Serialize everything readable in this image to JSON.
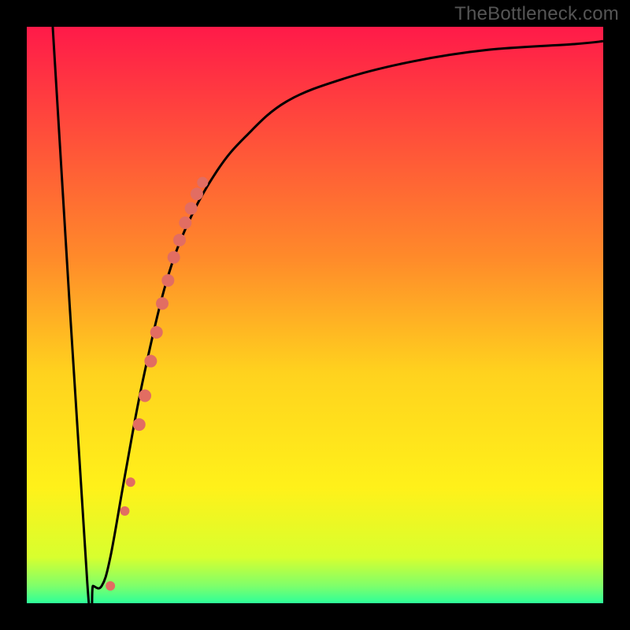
{
  "watermark": {
    "text": "TheBottleneck.com"
  },
  "chart_data": {
    "type": "line",
    "title": "",
    "xlabel": "",
    "ylabel": "",
    "xlim": [
      0,
      100
    ],
    "ylim": [
      0,
      100
    ],
    "grid": false,
    "background_gradient_stops": [
      {
        "offset": 0.0,
        "color": "#ff1a49"
      },
      {
        "offset": 0.4,
        "color": "#ff8a2a"
      },
      {
        "offset": 0.6,
        "color": "#ffd21e"
      },
      {
        "offset": 0.8,
        "color": "#fff11a"
      },
      {
        "offset": 0.92,
        "color": "#d8ff2e"
      },
      {
        "offset": 0.97,
        "color": "#7eff6b"
      },
      {
        "offset": 1.0,
        "color": "#2dff9a"
      }
    ],
    "series": [
      {
        "name": "bottleneck-curve",
        "color": "#000000",
        "x": [
          4.5,
          10.5,
          11.5,
          13,
          14.5,
          17,
          20,
          24,
          28,
          33,
          38,
          45,
          55,
          67,
          80,
          95,
          100
        ],
        "values": [
          100,
          3.5,
          3.0,
          3,
          8,
          22,
          38,
          55,
          66,
          75,
          81,
          87,
          91,
          94,
          96,
          97,
          97.5
        ]
      }
    ],
    "highlight_points": {
      "name": "highlight-dots",
      "color": "#e26d62",
      "x": [
        14.5,
        17.0,
        18.0,
        19.5,
        20.5,
        21.5,
        22.5,
        23.5,
        24.5,
        25.5,
        26.5,
        27.5,
        28.5,
        29.5,
        30.5
      ],
      "values": [
        3.0,
        16.0,
        21.0,
        31.0,
        36.0,
        42.0,
        47.0,
        52.0,
        56.0,
        60.0,
        63.0,
        66.0,
        68.5,
        71.0,
        73.0
      ],
      "r": [
        6,
        6,
        6,
        8,
        8,
        8,
        8,
        8,
        8,
        8,
        8,
        8,
        8,
        8,
        7
      ]
    }
  }
}
